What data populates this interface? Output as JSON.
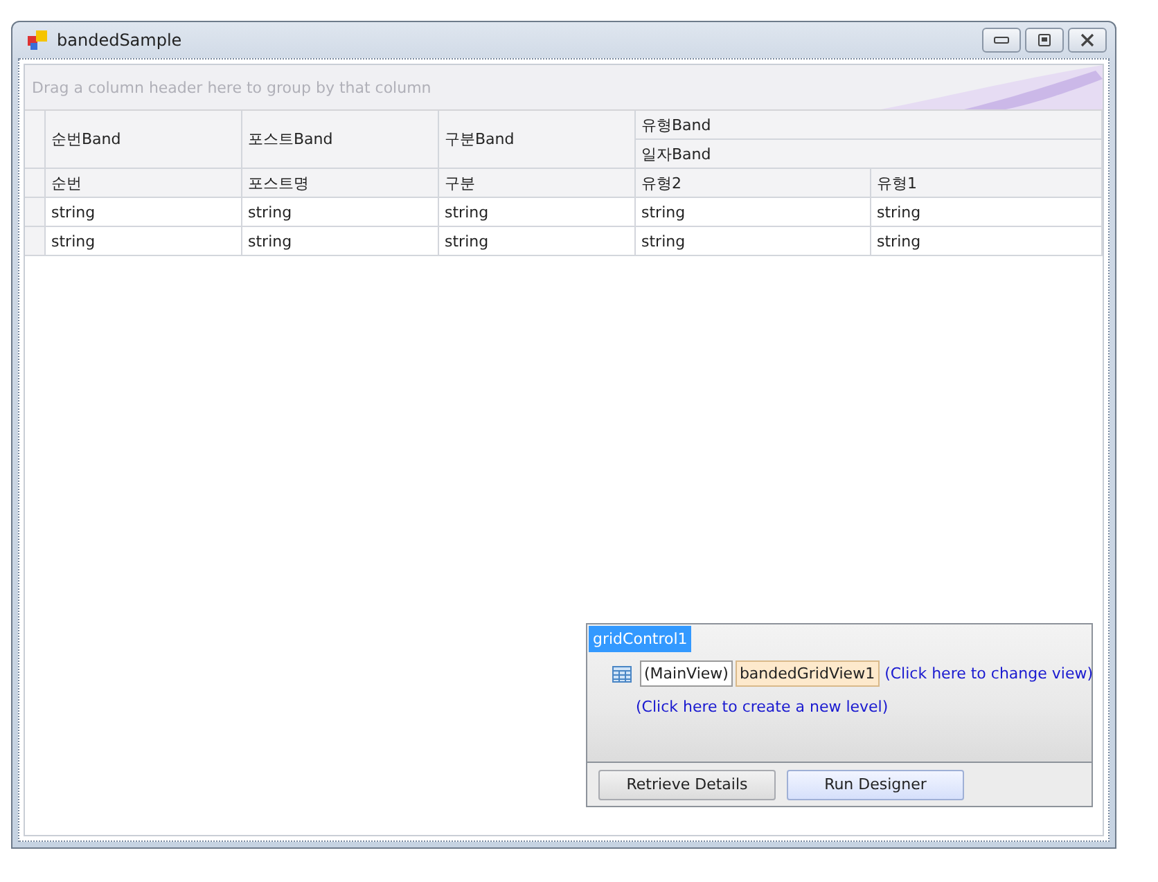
{
  "window": {
    "title": "bandedSample"
  },
  "group_panel": {
    "placeholder": "Drag a column header here to group by that column"
  },
  "bands": [
    {
      "label": "순번Band"
    },
    {
      "label": "포스트Band"
    },
    {
      "label": "구분Band"
    },
    {
      "label": "유형Band",
      "children": [
        {
          "label": "일자Band"
        }
      ]
    }
  ],
  "columns": [
    "순번",
    "포스트명",
    "구분",
    "유형2",
    "유형1"
  ],
  "rows": [
    [
      "string",
      "string",
      "string",
      "string",
      "string"
    ],
    [
      "string",
      "string",
      "string",
      "string",
      "string"
    ]
  ],
  "designer": {
    "title": "gridControl1",
    "main_view": "(MainView)",
    "view_name": "bandedGridView1",
    "change_view_link": "(Click here to change view)",
    "new_level_link": "(Click here to create a new level)",
    "buttons": [
      {
        "label": "Retrieve Details",
        "selected": false
      },
      {
        "label": "Run Designer",
        "selected": true
      }
    ]
  }
}
